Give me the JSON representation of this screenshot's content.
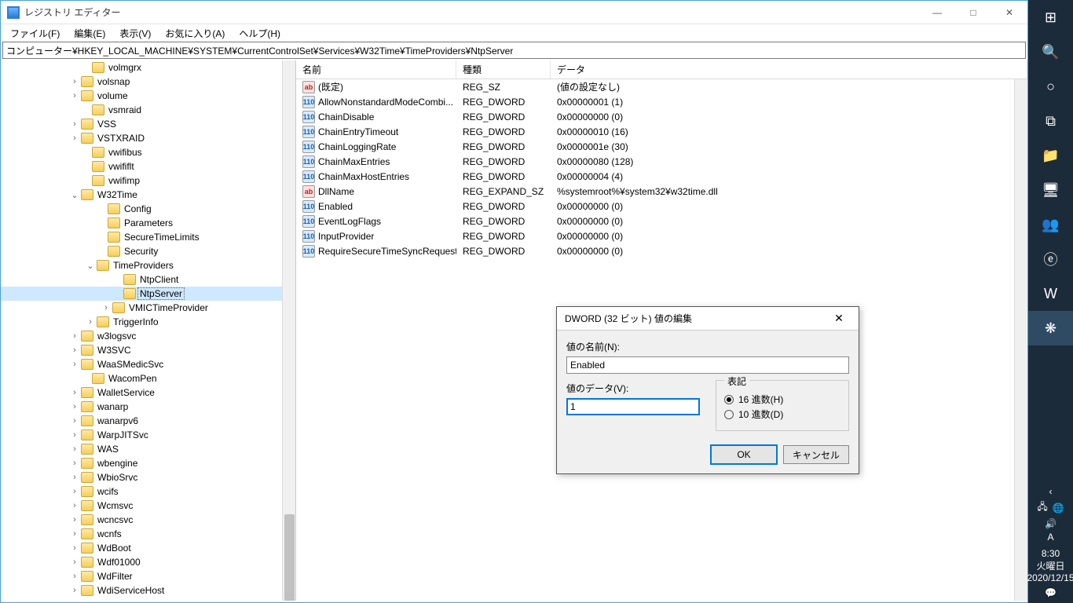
{
  "window": {
    "title": "レジストリ エディター",
    "menu": [
      "ファイル(F)",
      "編集(E)",
      "表示(V)",
      "お気に入り(A)",
      "ヘルプ(H)"
    ],
    "address": "コンピューター¥HKEY_LOCAL_MACHINE¥SYSTEM¥CurrentControlSet¥Services¥W32Time¥TimeProviders¥NtpServer",
    "win_min": "—",
    "win_max": "□",
    "win_close": "✕"
  },
  "tree": [
    {
      "indent": 100,
      "expand": " ",
      "label": "volmgrx"
    },
    {
      "indent": 86,
      "expand": "›",
      "label": "volsnap"
    },
    {
      "indent": 86,
      "expand": "›",
      "label": "volume"
    },
    {
      "indent": 100,
      "expand": " ",
      "label": "vsmraid"
    },
    {
      "indent": 86,
      "expand": "›",
      "label": "VSS"
    },
    {
      "indent": 86,
      "expand": "›",
      "label": "VSTXRAID"
    },
    {
      "indent": 100,
      "expand": " ",
      "label": "vwifibus"
    },
    {
      "indent": 100,
      "expand": " ",
      "label": "vwififlt"
    },
    {
      "indent": 100,
      "expand": " ",
      "label": "vwifimp"
    },
    {
      "indent": 86,
      "expand": "⌄",
      "label": "W32Time"
    },
    {
      "indent": 120,
      "expand": " ",
      "label": "Config"
    },
    {
      "indent": 120,
      "expand": " ",
      "label": "Parameters"
    },
    {
      "indent": 120,
      "expand": " ",
      "label": "SecureTimeLimits"
    },
    {
      "indent": 120,
      "expand": " ",
      "label": "Security"
    },
    {
      "indent": 106,
      "expand": "⌄",
      "label": "TimeProviders"
    },
    {
      "indent": 140,
      "expand": " ",
      "label": "NtpClient"
    },
    {
      "indent": 140,
      "expand": " ",
      "label": "NtpServer",
      "selected": true
    },
    {
      "indent": 126,
      "expand": "›",
      "label": "VMICTimeProvider"
    },
    {
      "indent": 106,
      "expand": "›",
      "label": "TriggerInfo"
    },
    {
      "indent": 86,
      "expand": "›",
      "label": "w3logsvc"
    },
    {
      "indent": 86,
      "expand": "›",
      "label": "W3SVC"
    },
    {
      "indent": 86,
      "expand": "›",
      "label": "WaaSMedicSvc"
    },
    {
      "indent": 100,
      "expand": " ",
      "label": "WacomPen"
    },
    {
      "indent": 86,
      "expand": "›",
      "label": "WalletService"
    },
    {
      "indent": 86,
      "expand": "›",
      "label": "wanarp"
    },
    {
      "indent": 86,
      "expand": "›",
      "label": "wanarpv6"
    },
    {
      "indent": 86,
      "expand": "›",
      "label": "WarpJITSvc"
    },
    {
      "indent": 86,
      "expand": "›",
      "label": "WAS"
    },
    {
      "indent": 86,
      "expand": "›",
      "label": "wbengine"
    },
    {
      "indent": 86,
      "expand": "›",
      "label": "WbioSrvc"
    },
    {
      "indent": 86,
      "expand": "›",
      "label": "wcifs"
    },
    {
      "indent": 86,
      "expand": "›",
      "label": "Wcmsvc"
    },
    {
      "indent": 86,
      "expand": "›",
      "label": "wcncsvc"
    },
    {
      "indent": 86,
      "expand": "›",
      "label": "wcnfs"
    },
    {
      "indent": 86,
      "expand": "›",
      "label": "WdBoot"
    },
    {
      "indent": 86,
      "expand": "›",
      "label": "Wdf01000"
    },
    {
      "indent": 86,
      "expand": "›",
      "label": "WdFilter"
    },
    {
      "indent": 86,
      "expand": "›",
      "label": "WdiServiceHost"
    }
  ],
  "columns": {
    "name": "名前",
    "type": "種類",
    "data": "データ"
  },
  "values": [
    {
      "icon": "ab",
      "name": "(既定)",
      "type": "REG_SZ",
      "data": "(値の設定なし)"
    },
    {
      "icon": "dw",
      "name": "AllowNonstandardModeCombi...",
      "type": "REG_DWORD",
      "data": "0x00000001 (1)"
    },
    {
      "icon": "dw",
      "name": "ChainDisable",
      "type": "REG_DWORD",
      "data": "0x00000000 (0)"
    },
    {
      "icon": "dw",
      "name": "ChainEntryTimeout",
      "type": "REG_DWORD",
      "data": "0x00000010 (16)"
    },
    {
      "icon": "dw",
      "name": "ChainLoggingRate",
      "type": "REG_DWORD",
      "data": "0x0000001e (30)"
    },
    {
      "icon": "dw",
      "name": "ChainMaxEntries",
      "type": "REG_DWORD",
      "data": "0x00000080 (128)"
    },
    {
      "icon": "dw",
      "name": "ChainMaxHostEntries",
      "type": "REG_DWORD",
      "data": "0x00000004 (4)"
    },
    {
      "icon": "ab",
      "name": "DllName",
      "type": "REG_EXPAND_SZ",
      "data": "%systemroot%¥system32¥w32time.dll"
    },
    {
      "icon": "dw",
      "name": "Enabled",
      "type": "REG_DWORD",
      "data": "0x00000000 (0)"
    },
    {
      "icon": "dw",
      "name": "EventLogFlags",
      "type": "REG_DWORD",
      "data": "0x00000000 (0)"
    },
    {
      "icon": "dw",
      "name": "InputProvider",
      "type": "REG_DWORD",
      "data": "0x00000000 (0)"
    },
    {
      "icon": "dw",
      "name": "RequireSecureTimeSyncRequests",
      "type": "REG_DWORD",
      "data": "0x00000000 (0)"
    }
  ],
  "dialog": {
    "title": "DWORD (32 ビット) 値の編集",
    "name_label": "値の名前(N):",
    "name_value": "Enabled",
    "data_label": "値のデータ(V):",
    "data_value": "1",
    "radix_label": "表記",
    "radix_hex": "16 進数(H)",
    "radix_dec": "10 進数(D)",
    "ok": "OK",
    "cancel": "キャンセル",
    "close": "✕"
  },
  "taskbar": {
    "icons": [
      "⊞",
      "🔍",
      "○",
      "⧉",
      "📁",
      "🖥",
      "👥",
      "ⓔ",
      "W",
      "❋"
    ],
    "chev": "‹",
    "net": "🖧",
    "globe": "🌐",
    "vol": "🔊",
    "ime": "A",
    "msg": "💬",
    "time": "8:30",
    "day": "火曜日",
    "date": "2020/12/15"
  }
}
